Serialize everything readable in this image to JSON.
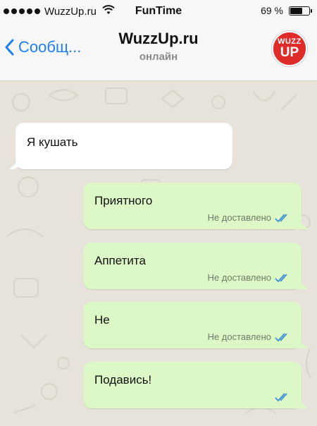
{
  "status_bar": {
    "carrier": "WuzzUp.ru",
    "app_name": "FunTime",
    "battery_percent": "69 %",
    "battery_level": 0.69
  },
  "header": {
    "back_label": "Сообщ...",
    "title": "WuzzUp.ru",
    "subtitle": "онлайн",
    "avatar_line1": "WUZZ",
    "avatar_line2": "UP"
  },
  "colors": {
    "accent": "#1d7ff5",
    "outgoing_bubble": "#dcf8c6",
    "incoming_bubble": "#ffffff",
    "avatar_bg": "#e02b2b",
    "tick_color": "#3d8fd8"
  },
  "messages": [
    {
      "direction": "incoming",
      "text": "Я кушать"
    },
    {
      "direction": "outgoing",
      "text": "Приятного",
      "status": "Не доставлено"
    },
    {
      "direction": "outgoing",
      "text": "Аппетита",
      "status": "Не доставлено"
    },
    {
      "direction": "outgoing",
      "text": "Не",
      "status": "Не доставлено"
    },
    {
      "direction": "outgoing",
      "text": "Подавись!",
      "status": ""
    }
  ]
}
